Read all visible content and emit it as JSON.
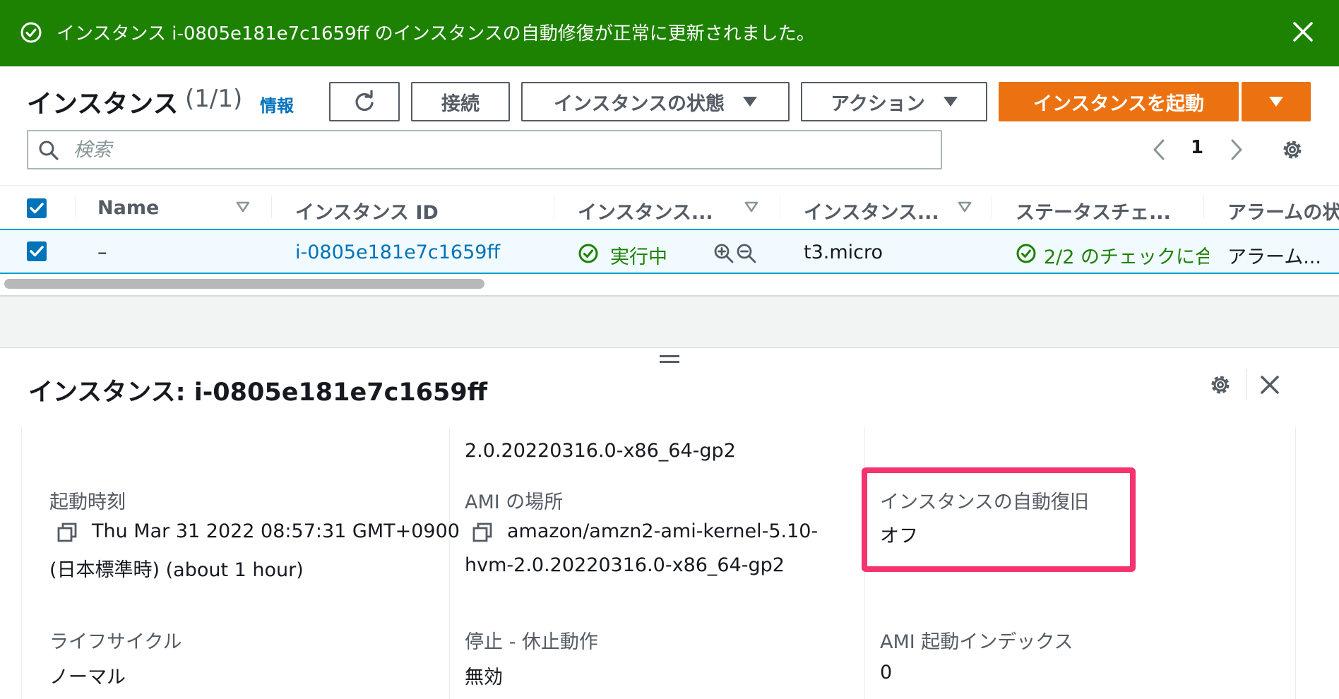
{
  "flash": {
    "message": "インスタンス i-0805e181e7c1659ff のインスタンスの自動修復が正常に更新されました。"
  },
  "header": {
    "title": "インスタンス",
    "count": "(1/1)",
    "info": "情報",
    "connect": "接続",
    "instance_state": "インスタンスの状態",
    "actions": "アクション",
    "launch": "インスタンスを起動"
  },
  "search": {
    "placeholder": "検索"
  },
  "pagination": {
    "page": "1"
  },
  "table": {
    "columns": [
      "Name",
      "インスタンス ID",
      "インスタンス...",
      "インスタンス...",
      "ステータスチェ...",
      "アラームの状"
    ],
    "row": {
      "name": "–",
      "instance_id": "i-0805e181e7c1659ff",
      "state": "実行中",
      "type": "t3.micro",
      "status_check": "2/2 のチェックに合",
      "alarm": "アラーム..."
    }
  },
  "details": {
    "title": "インスタンス: i-0805e181e7c1659ff",
    "ami_name_tail": "2.0.20220316.0-x86_64-gp2",
    "launch_time_label": "起動時刻",
    "launch_time_line1": "Thu Mar 31 2022 08:57:31 GMT+0900",
    "launch_time_line2": "(日本標準時) (about 1 hour)",
    "ami_location_label": "AMI の場所",
    "ami_location_line1": "amazon/amzn2-ami-kernel-5.10-",
    "ami_location_line2": "hvm-2.0.20220316.0-x86_64-gp2",
    "auto_recovery_label": "インスタンスの自動復旧",
    "auto_recovery_value": "オフ",
    "lifecycle_label": "ライフサイクル",
    "lifecycle_value": "ノーマル",
    "stop_hibernate_label": "停止 - 休止動作",
    "stop_hibernate_value": "無効",
    "ami_launch_index_label": "AMI 起動インデックス",
    "ami_launch_index_value": "0"
  },
  "colors": {
    "success": "#1d8102",
    "primary": "#ec7211",
    "link": "#0073bb",
    "highlight": "#f5336f"
  }
}
